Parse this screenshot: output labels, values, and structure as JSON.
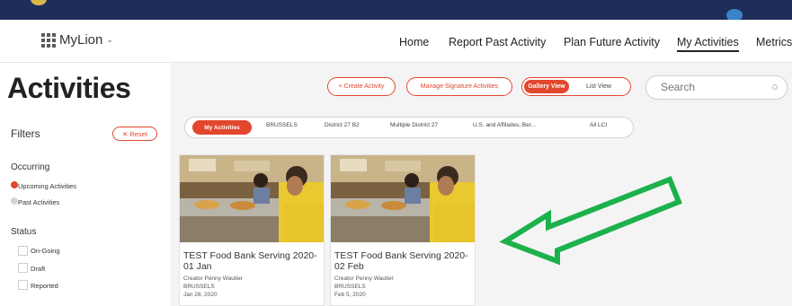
{
  "nav": {
    "brand": "MyLion",
    "links": [
      "Home",
      "Report Past Activity",
      "Plan Future Activity",
      "My Activities",
      "Metrics"
    ]
  },
  "page": {
    "title": "Activities"
  },
  "toolbar": {
    "create_label": "+ Create Activity",
    "manage_label": "Manage Signature Activities",
    "gallery_label": "Gallery View",
    "list_label": "List View",
    "search_placeholder": "Search"
  },
  "filters": {
    "heading": "Filters",
    "reset_label": "Reset",
    "occurring_label": "Occurring",
    "occurring_options": [
      "Upcoming Activities",
      "Past Activities"
    ],
    "status_label": "Status",
    "status_options": [
      "On-Going",
      "Draft",
      "Reported"
    ]
  },
  "tabs": [
    "My Activities",
    "BRUSSELS",
    "District 27 B2",
    "Multiple District 27",
    "U.S. and Affiliates, Ber...",
    "All LCI"
  ],
  "cards": [
    {
      "title": "TEST Food Bank Serving 2020-01 Jan",
      "creator": "Creator Penny Wautier",
      "club": "BRUSSELS",
      "date": "Jan 28, 2020"
    },
    {
      "title": "TEST Food Bank Serving 2020-02 Feb",
      "creator": "Creator Penny Wautier",
      "club": "BRUSSELS",
      "date": "Feb 5, 2020"
    }
  ],
  "colors": {
    "accent": "#e2462d",
    "header_bar": "#1f2d5a",
    "annotation_arrow": "#1db14b"
  }
}
